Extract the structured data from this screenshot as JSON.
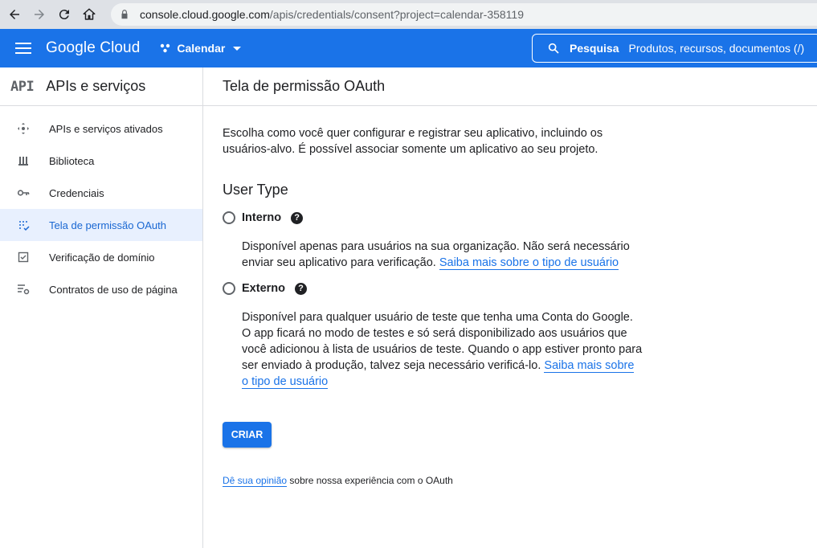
{
  "browser": {
    "url_host": "console.cloud.google.com",
    "url_path": "/apis/credentials/consent?project=calendar-358119"
  },
  "header": {
    "logo": "Google Cloud",
    "project": "Calendar",
    "search_label": "Pesquisa",
    "search_placeholder": "Produtos, recursos, documentos (/)"
  },
  "sidebar": {
    "api_mark": "API",
    "title": "APIs e serviços",
    "items": [
      {
        "label": "APIs e serviços ativados",
        "icon": "dashboard-icon"
      },
      {
        "label": "Biblioteca",
        "icon": "library-icon"
      },
      {
        "label": "Credenciais",
        "icon": "key-icon"
      },
      {
        "label": "Tela de permissão OAuth",
        "icon": "consent-icon",
        "active": true
      },
      {
        "label": "Verificação de domínio",
        "icon": "checkbox-icon"
      },
      {
        "label": "Contratos de uso de página",
        "icon": "settings-list-icon"
      }
    ]
  },
  "main": {
    "title": "Tela de permissão OAuth",
    "intro": "Escolha como você quer configurar e registrar seu aplicativo, incluindo os usuários-alvo. É possível associar somente um aplicativo ao seu projeto.",
    "section_title": "User Type",
    "options": [
      {
        "label": "Interno",
        "desc": "Disponível apenas para usuários na sua organização. Não será necessário enviar seu aplicativo para verificação. ",
        "link": "Saiba mais sobre o tipo de usuário"
      },
      {
        "label": "Externo",
        "desc": "Disponível para qualquer usuário de teste que tenha uma Conta do Google. O app ficará no modo de testes e só será disponibilizado aos usuários que você adicionou à lista de usuários de teste. Quando o app estiver pronto para ser enviado à produção, talvez seja necessário verificá-lo. ",
        "link": "Saiba mais sobre o tipo de usuário"
      }
    ],
    "create_label": "CRIAR",
    "feedback_link": "Dê sua opinião",
    "feedback_text": " sobre nossa experiência com o OAuth"
  },
  "colors": {
    "brand_blue": "#1a73e8",
    "active_bg": "#e8f0fe"
  }
}
